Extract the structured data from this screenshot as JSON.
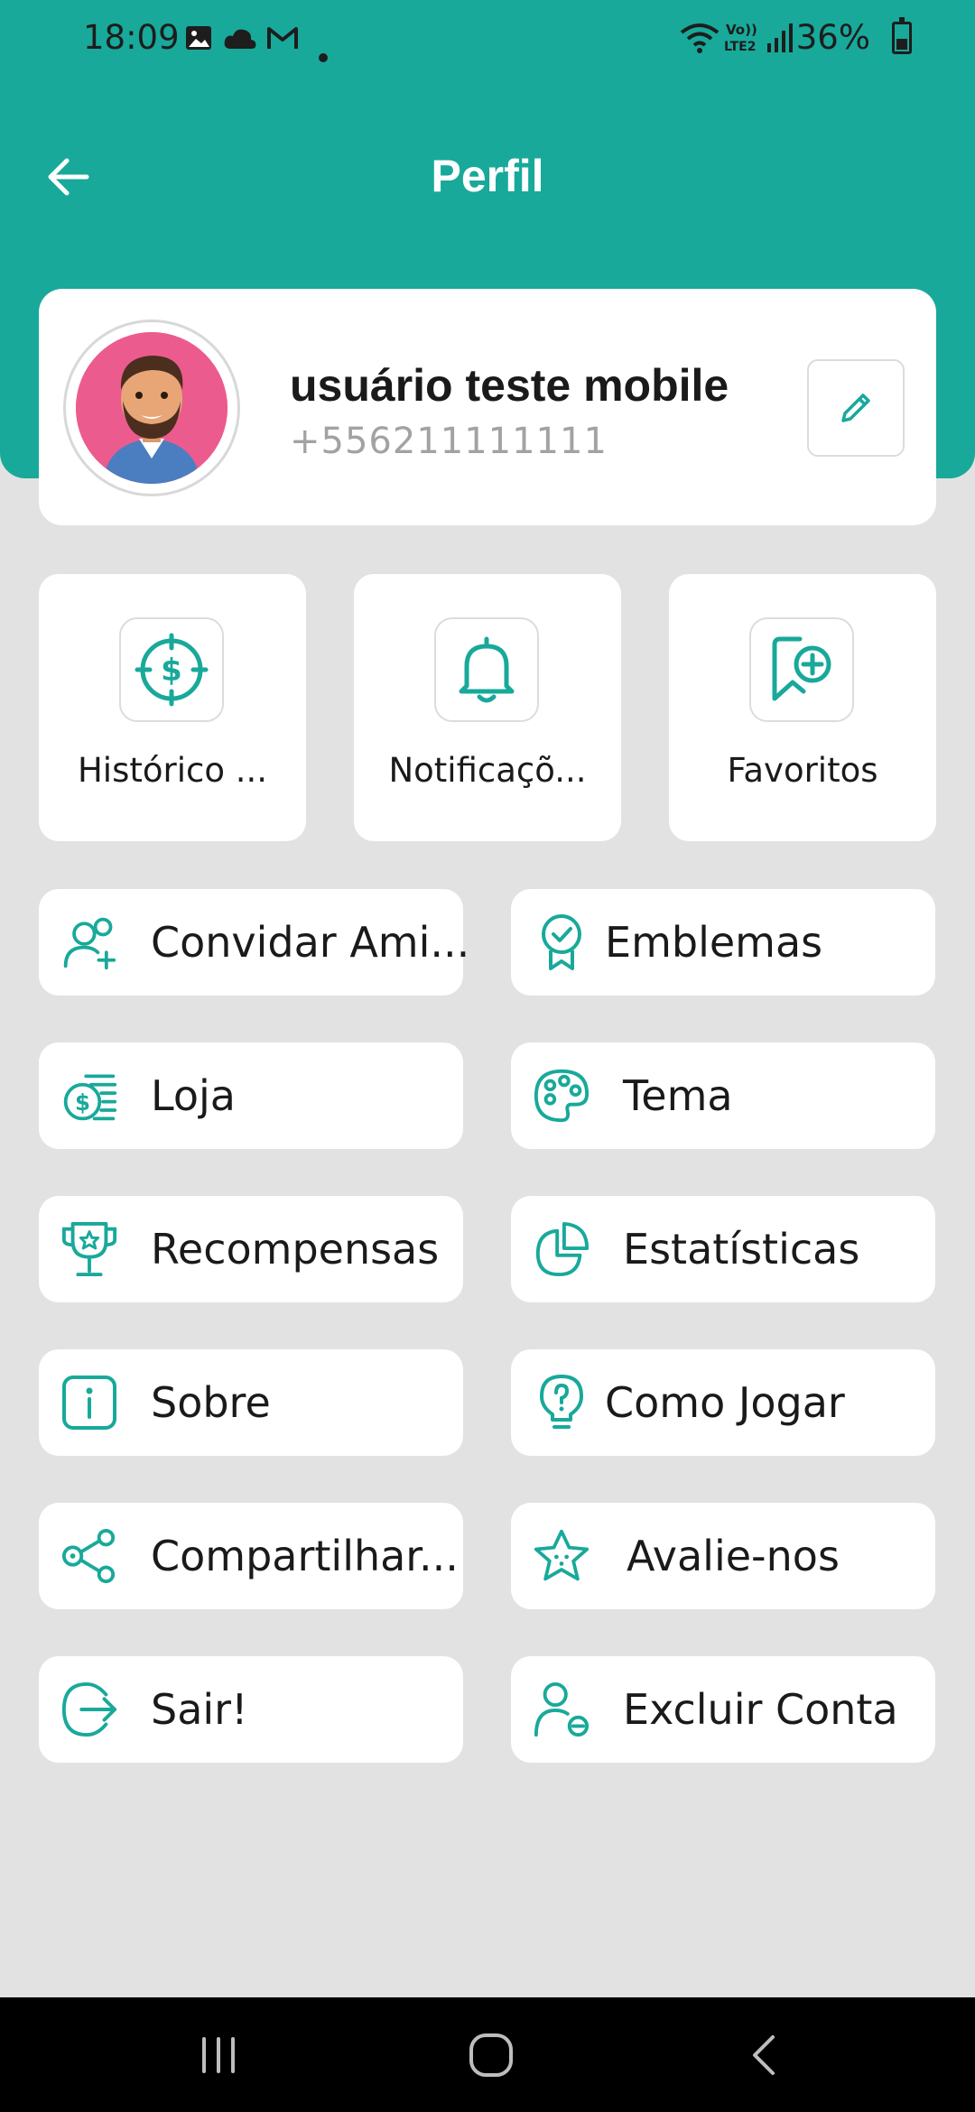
{
  "status_bar": {
    "time": "18:09",
    "battery": "36%",
    "icons": [
      "gallery-icon",
      "cloud-icon",
      "gmail-icon",
      "dot-icon",
      "wifi-icon",
      "volte-icon",
      "signal-icon",
      "battery-icon"
    ]
  },
  "header": {
    "title": "Perfil",
    "color": "#18a99a"
  },
  "profile": {
    "name": "usuário teste mobile",
    "phone": "+556211111111"
  },
  "tiles": [
    {
      "label": "Histórico ...",
      "icon": "dollar-target-icon"
    },
    {
      "label": "Notificaçõ...",
      "icon": "bell-icon"
    },
    {
      "label": "Favoritos",
      "icon": "bookmark-plus-icon"
    }
  ],
  "menu": {
    "invite": "Convidar Ami...",
    "badges": "Emblemas",
    "store": "Loja",
    "theme": "Tema",
    "rewards": "Recompensas",
    "stats": "Estatísticas",
    "about": "Sobre",
    "how_to_play": "Como Jogar",
    "share": "Compartilhar...",
    "rate": "Avalie-nos",
    "logout": "Sair!",
    "delete_account": "Excluir Conta"
  },
  "accent_color": "#18a99a"
}
